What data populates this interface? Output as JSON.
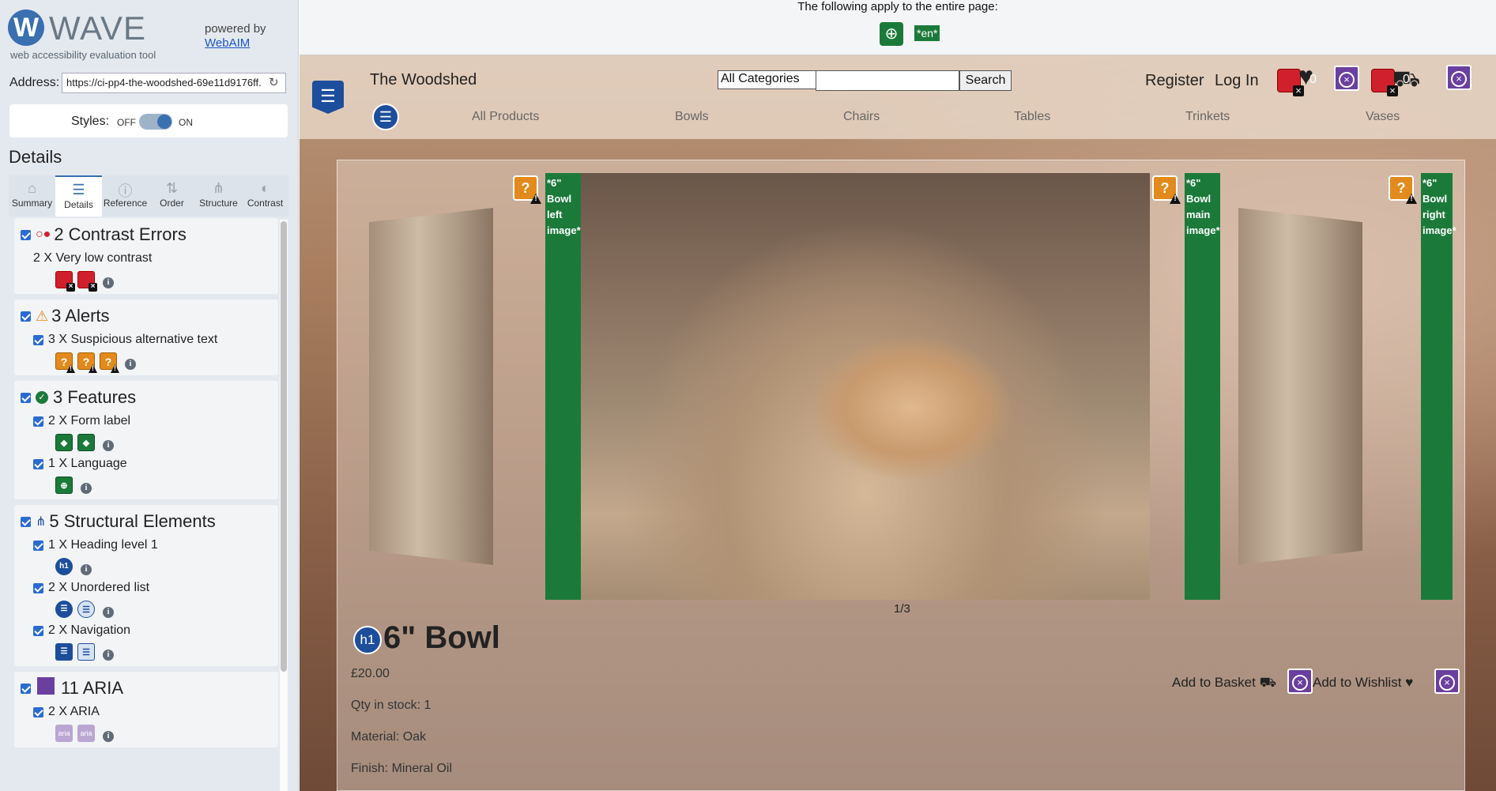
{
  "wave": {
    "logo_text": "WAVE",
    "logo_sub": "web accessibility evaluation tool",
    "powered_by": "powered by",
    "webaim_link": "WebAIM",
    "address_label": "Address:",
    "address_value": "https://ci-pp4-the-woodshed-69e11d9176ff.",
    "styles_label": "Styles:",
    "styles_off": "OFF",
    "styles_on": "ON",
    "styles_state": "on",
    "details_heading": "Details",
    "tabs": [
      {
        "label": "Summary",
        "icon": "home-icon"
      },
      {
        "label": "Details",
        "icon": "list-icon"
      },
      {
        "label": "Reference",
        "icon": "info-icon"
      },
      {
        "label": "Order",
        "icon": "order-icon"
      },
      {
        "label": "Structure",
        "icon": "structure-icon"
      },
      {
        "label": "Contrast",
        "icon": "contrast-icon"
      }
    ],
    "active_tab": "Details",
    "sections": {
      "contrast": {
        "title": "2 Contrast Errors",
        "items": [
          {
            "label": "2 X Very low contrast"
          }
        ]
      },
      "alerts": {
        "title": "3 Alerts",
        "items": [
          {
            "label": "3 X Suspicious alternative text"
          }
        ]
      },
      "features": {
        "title": "3 Features",
        "items": [
          {
            "label": "2 X Form label"
          },
          {
            "label": "1 X Language"
          }
        ]
      },
      "structure": {
        "title": "5 Structural Elements",
        "items": [
          {
            "label": "1 X Heading level 1",
            "icon_text": "h1"
          },
          {
            "label": "2 X Unordered list"
          },
          {
            "label": "2 X Navigation"
          }
        ]
      },
      "aria": {
        "title": "11 ARIA",
        "items": [
          {
            "label": "2 X ARIA",
            "icon_text": "aria"
          }
        ]
      }
    }
  },
  "site": {
    "page_notice": "The following apply to the entire page:",
    "lang_badge": "*en*",
    "brand": "The Woodshed",
    "category_select": "All Categories",
    "search_placeholder": "",
    "search_button": "Search",
    "register": "Register",
    "login": "Log In",
    "wishlist_count": "0",
    "basket_count": "0",
    "nav": [
      "All Products",
      "Bowls",
      "Chairs",
      "Tables",
      "Trinkets",
      "Vases"
    ],
    "images": {
      "left_alt": "*6\" Bowl left image*",
      "main_alt": "*6\" Bowl main image*",
      "right_alt": "*6\" Bowl right image*"
    },
    "carousel_counter": "1/3",
    "h1_badge": "h1",
    "product": {
      "title": "6\" Bowl",
      "price": "£20.00",
      "stock": "Qty in stock: 1",
      "material": "Material: Oak",
      "finish": "Finish: Mineral Oil",
      "add_basket": "Add to Basket",
      "add_wishlist": "Add to Wishlist"
    }
  }
}
